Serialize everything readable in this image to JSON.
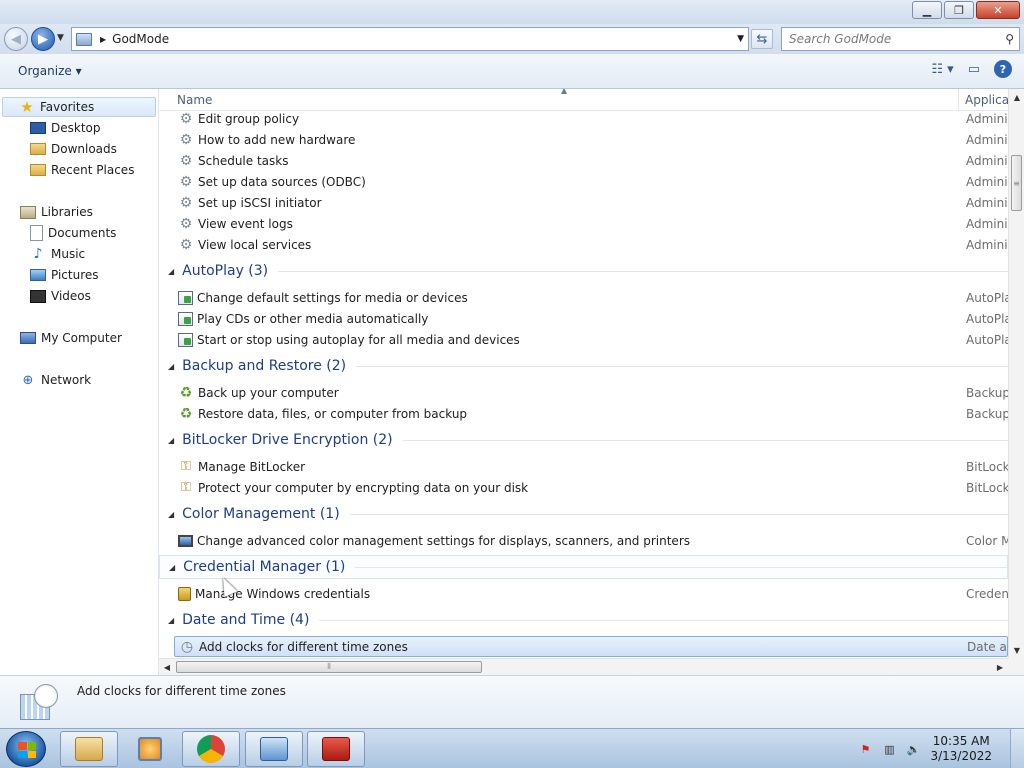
{
  "window": {
    "minimize": "▁",
    "maximize": "❐",
    "close": "✕"
  },
  "address": {
    "path": "GodMode",
    "search_placeholder": "Search GodMode"
  },
  "toolbar": {
    "organize": "Organize ▾",
    "views_icon": "views-icon",
    "preview_icon": "preview-pane-icon",
    "help": "?"
  },
  "sidebar": {
    "favorites": {
      "label": "Favorites",
      "items": [
        "Desktop",
        "Downloads",
        "Recent Places"
      ]
    },
    "libraries": {
      "label": "Libraries",
      "items": [
        "Documents",
        "Music",
        "Pictures",
        "Videos"
      ]
    },
    "computer": "My Computer",
    "network": "Network"
  },
  "columns": {
    "name": "Name",
    "app": "Applica"
  },
  "rows_top": [
    {
      "label": "Edit group policy",
      "app": "Adminis"
    },
    {
      "label": "How to add new hardware",
      "app": "Adminis"
    },
    {
      "label": "Schedule tasks",
      "app": "Adminis"
    },
    {
      "label": "Set up data sources (ODBC)",
      "app": "Adminis"
    },
    {
      "label": "Set up iSCSI initiator",
      "app": "Adminis"
    },
    {
      "label": "View event logs",
      "app": "Adminis"
    },
    {
      "label": "View local services",
      "app": "Adminis"
    }
  ],
  "groups": {
    "autoplay": {
      "title": "AutoPlay (3)",
      "rows": [
        {
          "label": "Change default settings for media or devices",
          "app": "AutoPla"
        },
        {
          "label": "Play CDs or other media automatically",
          "app": "AutoPla"
        },
        {
          "label": "Start or stop using autoplay for all media and devices",
          "app": "AutoPla"
        }
      ]
    },
    "backup": {
      "title": "Backup and Restore (2)",
      "rows": [
        {
          "label": "Back up your computer",
          "app": "Backup"
        },
        {
          "label": "Restore data, files, or computer from backup",
          "app": "Backup"
        }
      ]
    },
    "bitlocker": {
      "title": "BitLocker Drive Encryption (2)",
      "rows": [
        {
          "label": "Manage BitLocker",
          "app": "BitLocke"
        },
        {
          "label": "Protect your computer by encrypting data on your disk",
          "app": "BitLocke"
        }
      ]
    },
    "color": {
      "title": "Color Management (1)",
      "rows": [
        {
          "label": "Change advanced color management settings for displays, scanners, and printers",
          "app": "Color M"
        }
      ]
    },
    "credential": {
      "title": "Credential Manager (1)",
      "rows": [
        {
          "label": "Manage Windows credentials",
          "app": "Credent"
        }
      ]
    },
    "datetime": {
      "title": "Date and Time (4)",
      "rows": [
        {
          "label": "Add clocks for different time zones",
          "app": "Date an"
        }
      ]
    }
  },
  "details": {
    "text": "Add clocks for different time zones"
  },
  "taskbar": {
    "time": "10:35 AM",
    "date": "3/13/2022",
    "apps": [
      "windows-explorer",
      "media-player",
      "chrome",
      "control-panel",
      "toolbox"
    ]
  }
}
